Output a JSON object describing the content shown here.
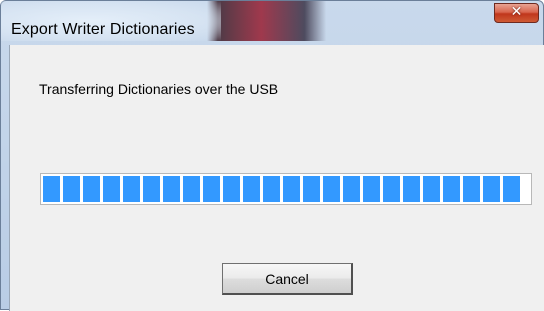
{
  "window": {
    "title": "Export Writer Dictionaries",
    "close_glyph": "✕"
  },
  "dialog": {
    "message": "Transferring Dictionaries over the USB",
    "progress": {
      "fraction": 1.0,
      "fill_color": "#3399ff"
    },
    "cancel_label": "Cancel"
  }
}
